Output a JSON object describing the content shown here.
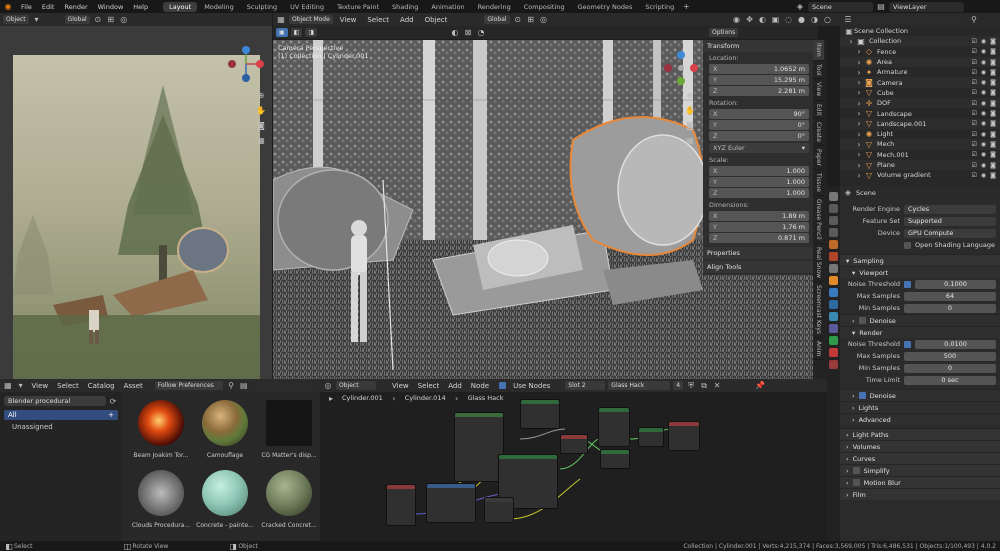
{
  "topbar": {
    "menus": [
      "File",
      "Edit",
      "Render",
      "Window",
      "Help"
    ],
    "workspaces": [
      "Layout",
      "Modeling",
      "Sculpting",
      "UV Editing",
      "Texture Paint",
      "Shading",
      "Animation",
      "Rendering",
      "Compositing",
      "Geometry Nodes",
      "Scripting"
    ],
    "active_workspace": "Layout",
    "scene": "Scene",
    "view_layer": "ViewLayer"
  },
  "left_header": {
    "mode": "Object",
    "orientation": "Global"
  },
  "main_header": {
    "mode": "Object Mode",
    "menus": [
      "View",
      "Select",
      "Add",
      "Object"
    ],
    "orientation": "Global",
    "options": "Options"
  },
  "viewport": {
    "camera_label": "Camera Perspective",
    "collection_label": "(1) Collection | Cylinder.001"
  },
  "npanel": {
    "transform_title": "Transform",
    "location_label": "Location:",
    "location": [
      {
        "axis": "X",
        "value": "1.0652 m"
      },
      {
        "axis": "Y",
        "value": "15.295 m"
      },
      {
        "axis": "Z",
        "value": "2.281 m"
      }
    ],
    "rotation_label": "Rotation:",
    "rotation": [
      {
        "axis": "X",
        "value": "90°"
      },
      {
        "axis": "Y",
        "value": "0°"
      },
      {
        "axis": "Z",
        "value": "0°"
      }
    ],
    "rotation_mode": "XYZ Euler",
    "scale_label": "Scale:",
    "scale": [
      {
        "axis": "X",
        "value": "1.000"
      },
      {
        "axis": "Y",
        "value": "1.000"
      },
      {
        "axis": "Z",
        "value": "1.000"
      }
    ],
    "dimensions_label": "Dimensions:",
    "dimensions": [
      {
        "axis": "X",
        "value": "1.89 m"
      },
      {
        "axis": "Y",
        "value": "1.76 m"
      },
      {
        "axis": "Z",
        "value": "0.871 m"
      }
    ],
    "properties": "Properties",
    "align_tools": "Align Tools"
  },
  "side_tabs": [
    "Item",
    "Tool",
    "View",
    "Edit",
    "Create",
    "Paper",
    "Tissue",
    "Grease Pencil",
    "Real Snow",
    "Screencast Keys",
    "Anim"
  ],
  "outliner": {
    "title": "Scene Collection",
    "items": [
      {
        "name": "Collection",
        "indent": 0,
        "icon": "collection-icon"
      },
      {
        "name": "Fence",
        "indent": 1,
        "icon": "object-icon"
      },
      {
        "name": "Area",
        "indent": 1,
        "icon": "light-icon"
      },
      {
        "name": "Armature",
        "indent": 1,
        "icon": "armature-icon"
      },
      {
        "name": "Camera",
        "indent": 1,
        "icon": "camera-icon"
      },
      {
        "name": "Cube",
        "indent": 1,
        "icon": "mesh-icon"
      },
      {
        "name": "DOF",
        "indent": 1,
        "icon": "empty-icon"
      },
      {
        "name": "Landscape",
        "indent": 1,
        "icon": "mesh-icon"
      },
      {
        "name": "Landscape.001",
        "indent": 1,
        "icon": "mesh-icon"
      },
      {
        "name": "Light",
        "indent": 1,
        "icon": "light-icon"
      },
      {
        "name": "Mech",
        "indent": 1,
        "icon": "mesh-icon"
      },
      {
        "name": "Mech.001",
        "indent": 1,
        "icon": "mesh-icon"
      },
      {
        "name": "Plane",
        "indent": 1,
        "icon": "mesh-icon"
      },
      {
        "name": "Volume gradient",
        "indent": 1,
        "icon": "mesh-icon"
      }
    ]
  },
  "properties": {
    "scene_label": "Scene",
    "render_engine_label": "Render Engine",
    "render_engine": "Cycles",
    "feature_set_label": "Feature Set",
    "feature_set": "Supported",
    "device_label": "Device",
    "device": "GPU Compute",
    "open_shading": "Open Shading Language",
    "sampling": "Sampling",
    "viewport": "Viewport",
    "noise_threshold_label": "Noise Threshold",
    "vp_noise": "0.1000",
    "max_samples_label": "Max Samples",
    "vp_max": "64",
    "min_samples_label": "Min Samples",
    "vp_min": "0",
    "denoise": "Denoise",
    "render": "Render",
    "r_noise": "0.0100",
    "r_max": "500",
    "r_min": "0",
    "time_limit_label": "Time Limit",
    "r_time": "0 sec",
    "lights": "Lights",
    "advanced": "Advanced",
    "sections": [
      "Light Paths",
      "Volumes",
      "Curves",
      "Simplify",
      "Motion Blur",
      "Film"
    ]
  },
  "assets": {
    "menus": [
      "View",
      "Select",
      "Catalog",
      "Asset"
    ],
    "follow": "Follow Preferences",
    "library": "Blender procedural",
    "catalogs": [
      {
        "name": "All",
        "active": true
      },
      {
        "name": "Unassigned",
        "active": false
      }
    ],
    "items": [
      {
        "name": "Beam Joakim Tor...",
        "color": "#c2411a"
      },
      {
        "name": "Camouflage",
        "color": "#a17a4a"
      },
      {
        "name": "CG Matter's disp...",
        "color": "#1a1a1a"
      },
      {
        "name": "Clouds Procedura...",
        "color": "#9a9a9a"
      },
      {
        "name": "Concrete - painte...",
        "color": "#8fc7b6"
      },
      {
        "name": "Cracked Concret...",
        "color": "#6e7b5a"
      }
    ]
  },
  "node_editor": {
    "mode": "Object",
    "menus": [
      "View",
      "Select",
      "Add",
      "Node"
    ],
    "use_nodes": "Use Nodes",
    "slot": "Slot 2",
    "material": "Glass Hack",
    "users": "4",
    "breadcrumb": [
      "Cylinder.001",
      "Cylinder.014",
      "Glass Hack"
    ]
  },
  "status": {
    "select": "Select",
    "rotate": "Rotate View",
    "object": "Object",
    "stats": "Collection | Cylinder.001 | Verts:4,215,374 | Faces:3,569,005 | Tris:6,486,531 | Objects:1/100,493 | 4.0.2"
  }
}
